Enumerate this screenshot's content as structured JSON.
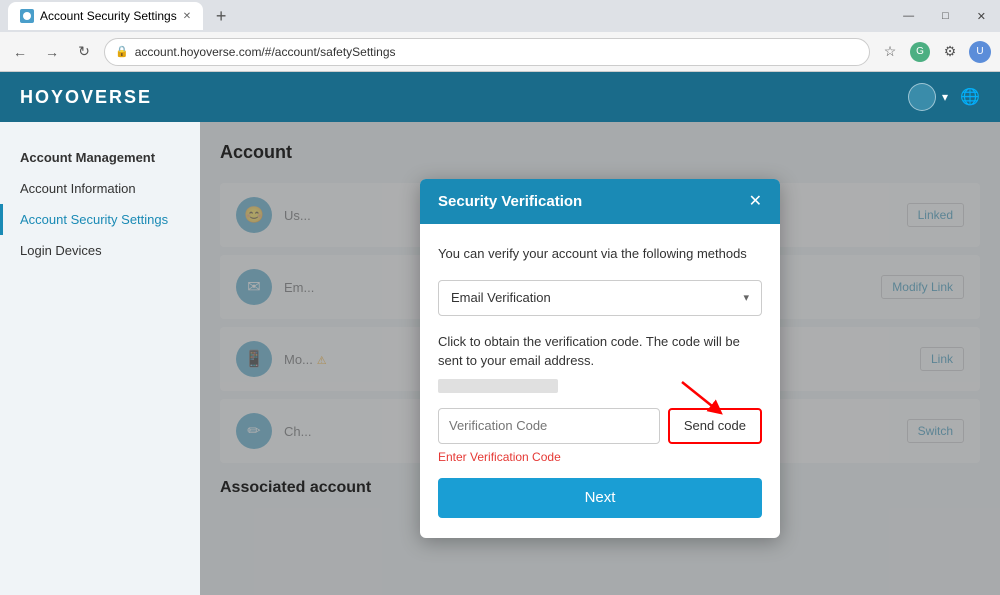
{
  "browser": {
    "tab_title": "Account Security Settings",
    "tab_new_label": "+",
    "address": "account.hoyoverse.com/#/account/safetySettings",
    "nav_back": "←",
    "nav_forward": "→",
    "nav_refresh": "↻",
    "win_minimize": "—",
    "win_maximize": "□",
    "win_close": "✕"
  },
  "header": {
    "logo": "HOYOVERSE",
    "user_label": "User",
    "globe_icon": "🌐"
  },
  "sidebar": {
    "section_label": "Account Management",
    "items": [
      {
        "label": "Account Information",
        "active": false
      },
      {
        "label": "Account Security Settings",
        "active": true
      },
      {
        "label": "Login Devices",
        "active": false
      }
    ]
  },
  "page": {
    "title": "Account",
    "rows": [
      {
        "icon": "😊",
        "label": "Us...",
        "action": "Linked"
      },
      {
        "icon": "✉️",
        "label": "Em...",
        "action": "Modify Link"
      },
      {
        "icon": "📱",
        "label": "Mo...",
        "action": "Link",
        "warning": "⚠"
      },
      {
        "icon": "✏️",
        "label": "Ch...",
        "action": "Switch"
      }
    ],
    "associated_section": "Associated account"
  },
  "modal": {
    "title": "Security Verification",
    "close_icon": "✕",
    "description": "You can verify your account via the following methods",
    "dropdown_value": "Email Verification",
    "dropdown_arrow": "▾",
    "click_instruction": "Click to obtain the verification code. The code will be sent to your email address.",
    "verification_placeholder": "Verification Code",
    "send_code_label": "Send code",
    "error_text": "Enter Verification Code",
    "next_label": "Next"
  }
}
